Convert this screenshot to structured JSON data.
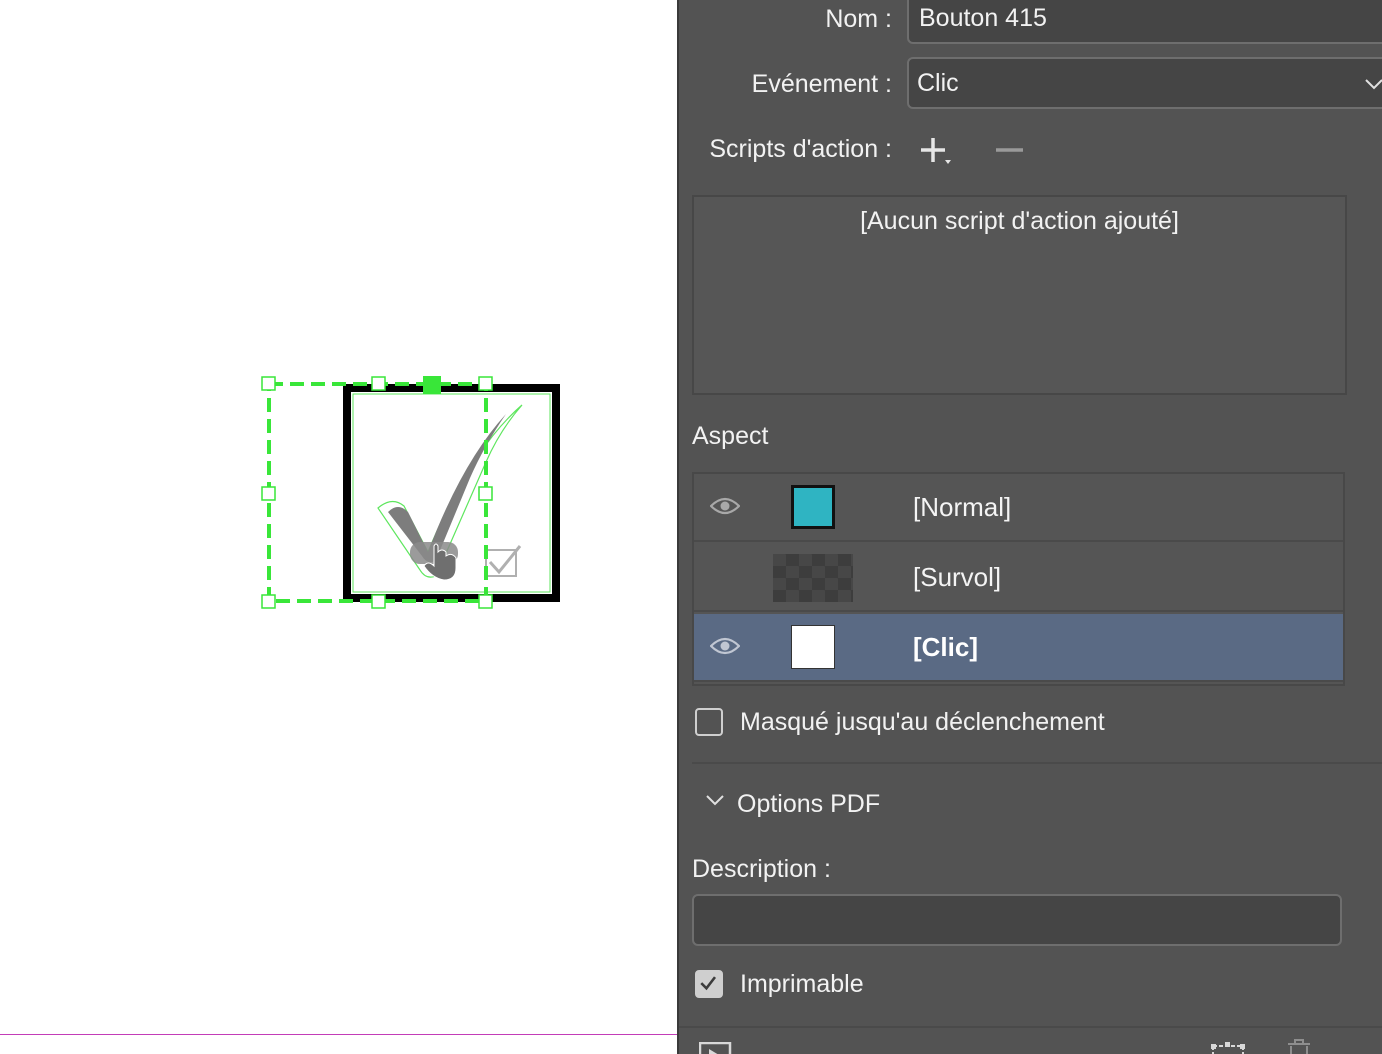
{
  "panel": {
    "name_label": "Nom :",
    "name_value": "Bouton 415",
    "event_label": "Evénement :",
    "event_value": "Clic",
    "scripts_label": "Scripts d'action :",
    "scripts_empty": "[Aucun script d'action ajouté]",
    "aspect_heading": "Aspect",
    "states": [
      {
        "label": "[Normal]",
        "visible": true,
        "swatch": "teal",
        "selected": false
      },
      {
        "label": "[Survol]",
        "visible": false,
        "swatch": "checker",
        "selected": false
      },
      {
        "label": "[Clic]",
        "visible": true,
        "swatch": "white",
        "selected": true
      }
    ],
    "hidden_until_label": "Masqué jusqu'au déclenchement",
    "hidden_until_checked": false,
    "pdf_options_label": "Options PDF",
    "description_label": "Description :",
    "description_value": "",
    "printable_label": "Imprimable",
    "printable_checked": true
  },
  "colors": {
    "panel_bg": "#535353",
    "selected_row": "#5a6a84",
    "normal_swatch": "#2fb4c2",
    "selection_green": "#39e639",
    "guide_magenta": "#c33db8"
  }
}
